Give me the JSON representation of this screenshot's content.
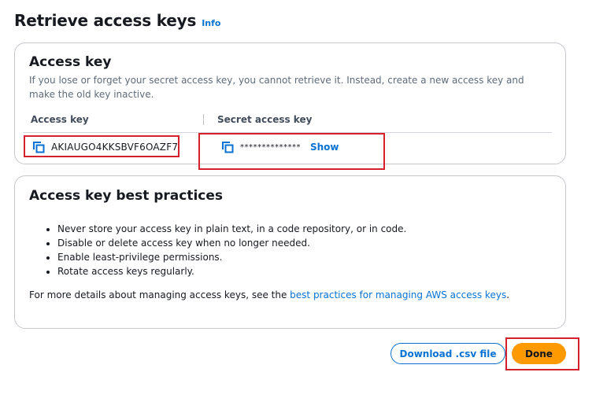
{
  "header": {
    "title": "Retrieve access keys",
    "info_link": "Info"
  },
  "access_key_card": {
    "title": "Access key",
    "description": "If you lose or forget your secret access key, you cannot retrieve it. Instead, create a new access key and make the old key inactive.",
    "columns": [
      "Access key",
      "Secret access key"
    ],
    "access_key_value": "AKIAUGO4KKSBVF6OAZF7",
    "secret_key_masked": "**************",
    "show_label": "Show"
  },
  "best_practices_card": {
    "title": "Access key best practices",
    "items": [
      "Never store your access key in plain text, in a code repository, or in code.",
      "Disable or delete access key when no longer needed.",
      "Enable least-privilege permissions.",
      "Rotate access keys regularly."
    ],
    "more_prefix": "For more details about managing access keys, see the ",
    "more_link": "best practices for managing AWS access keys",
    "more_suffix": "."
  },
  "actions": {
    "download_label": "Download .csv file",
    "done_label": "Done"
  },
  "icons": {
    "copy": "copy-icon"
  },
  "colors": {
    "link": "#0972d3",
    "primary_button": "#ff9900",
    "highlight": "#d6212c",
    "card_border": "#c6c6cd"
  }
}
